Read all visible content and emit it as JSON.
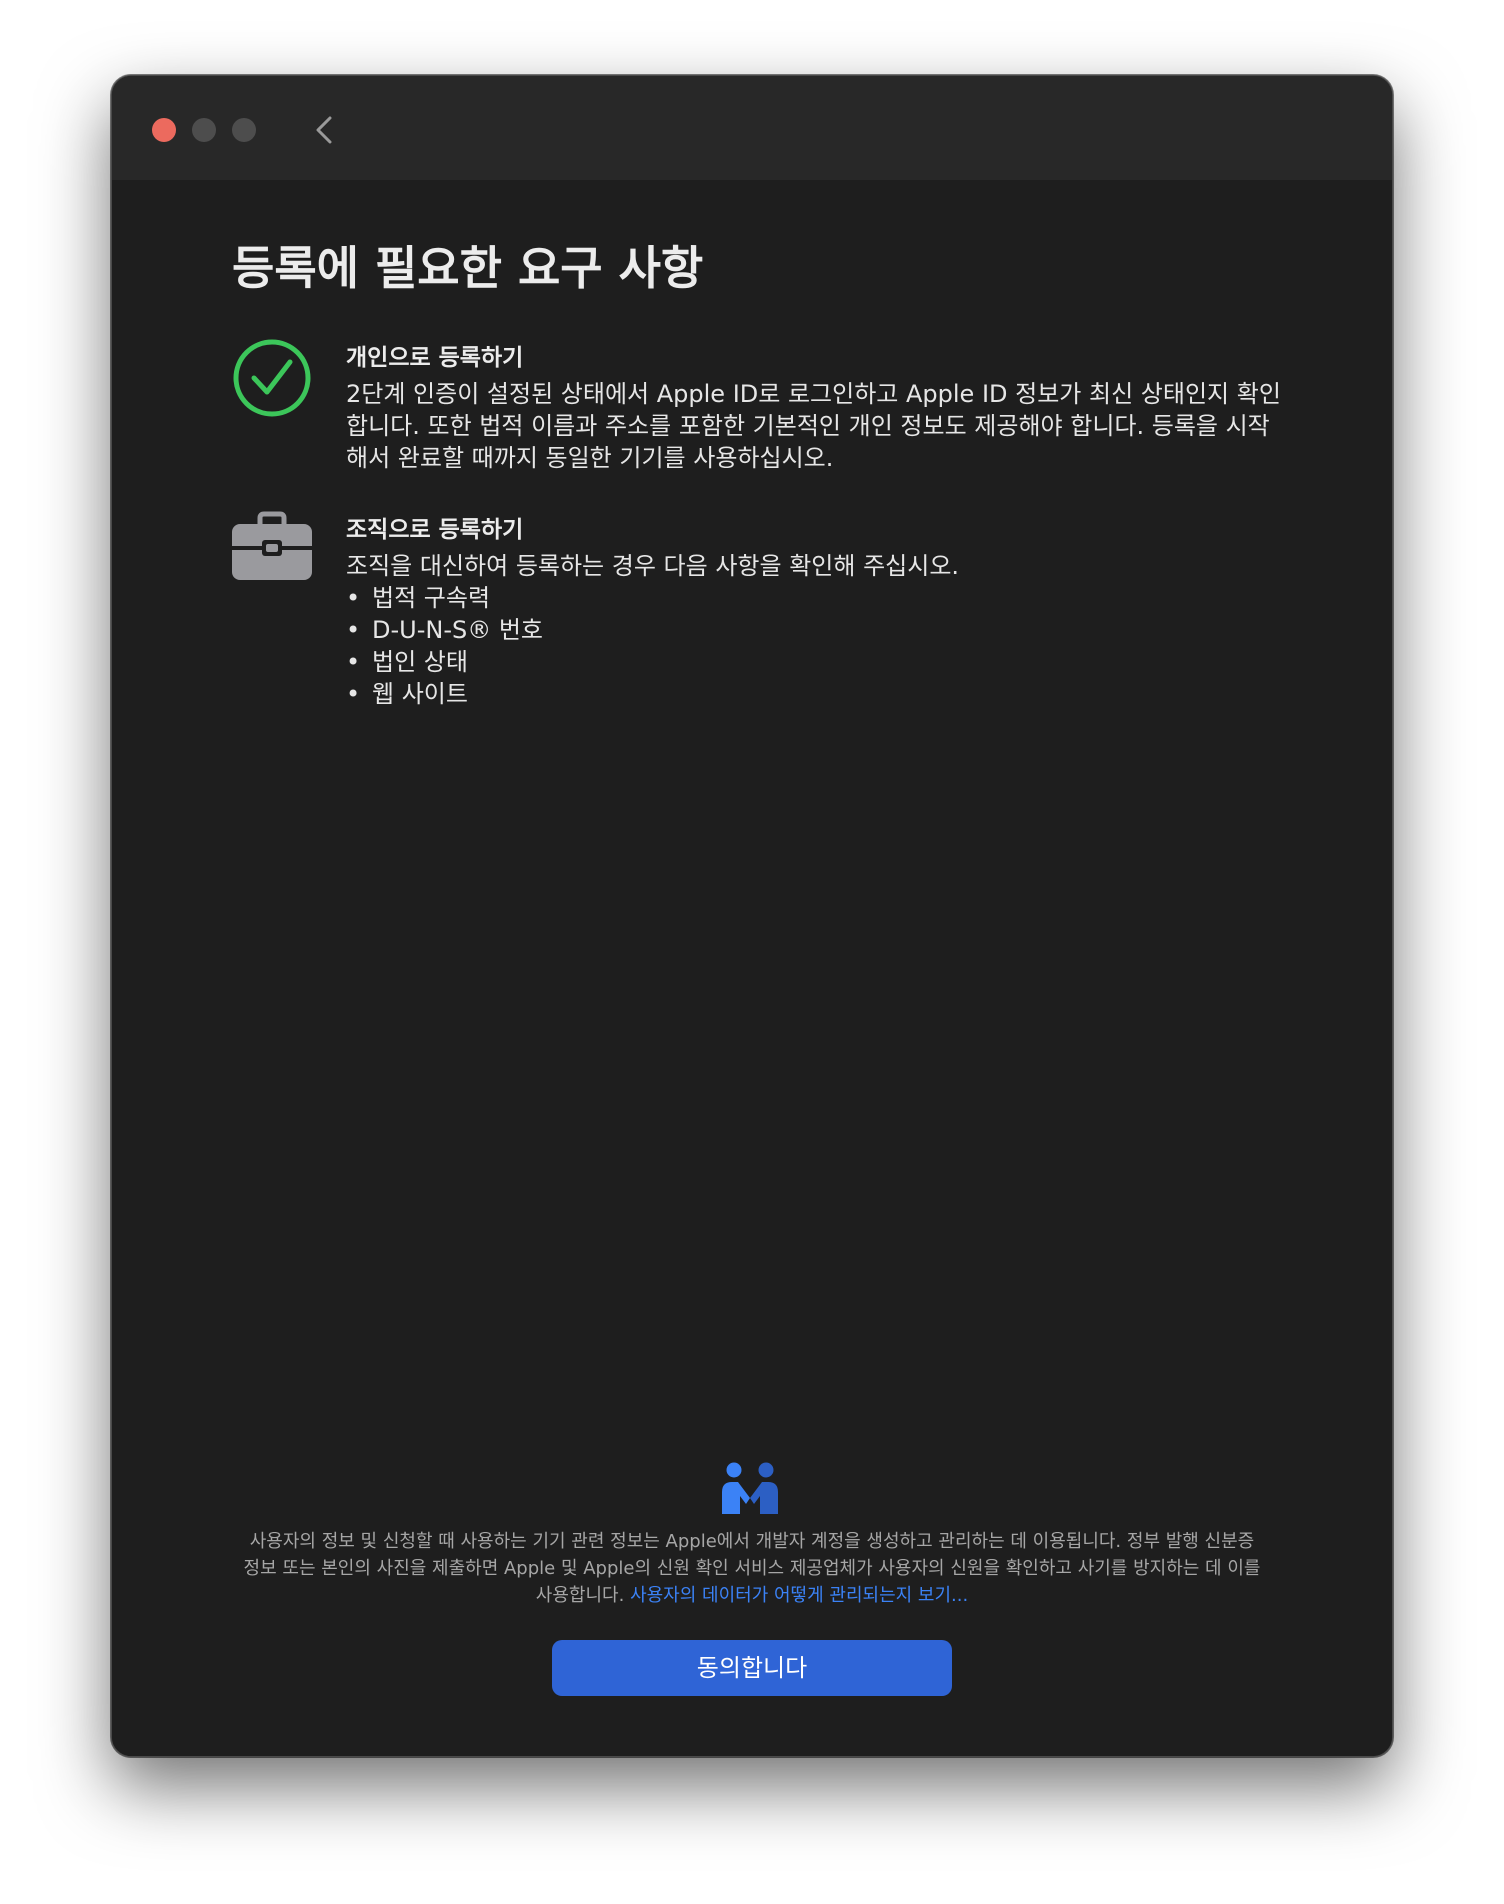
{
  "window": {
    "colors": {
      "background": "#1e1e1e",
      "titlebar": "#282828",
      "close": "#ec6a5e",
      "inactive_light": "#4d4d4d",
      "accent": "#2f64d6",
      "check_green": "#3cc65a",
      "link": "#3b82f6"
    }
  },
  "toolbar": {
    "back_icon": "chevron-left-icon"
  },
  "main": {
    "title": "등록에 필요한 요구 사항",
    "individual": {
      "icon": "checkmark-circle-icon",
      "title": "개인으로 등록하기",
      "body": "2단계 인증이 설정된 상태에서 Apple ID로 로그인하고 Apple ID 정보가 최신 상태인지 확인합니다. 또한 법적 이름과 주소를 포함한 기본적인 개인 정보도 제공해야 합니다. 등록을 시작해서 완료할 때까지 동일한 기기를 사용하십시오."
    },
    "organization": {
      "icon": "briefcase-icon",
      "title": "조직으로 등록하기",
      "body": "조직을 대신하여 등록하는 경우 다음 사항을 확인해 주십시오.",
      "items": [
        "법적 구속력",
        "D-U-N-S® 번호",
        "법인 상태",
        "웹 사이트"
      ]
    }
  },
  "footer": {
    "privacy_icon": "privacy-handshake-icon",
    "privacy_text": "사용자의 정보 및 신청할 때 사용하는 기기 관련 정보는 Apple에서 개발자 계정을 생성하고 관리하는 데 이용됩니다. 정부 발행 신분증 정보 또는 본인의 사진을 제출하면 Apple 및 Apple의 신원 확인 서비스 제공업체가 사용자의 신원을 확인하고 사기를 방지하는 데 이를 사용합니다.",
    "privacy_link": "사용자의 데이터가 어떻게 관리되는지 보기...",
    "agree_label": "동의합니다"
  }
}
